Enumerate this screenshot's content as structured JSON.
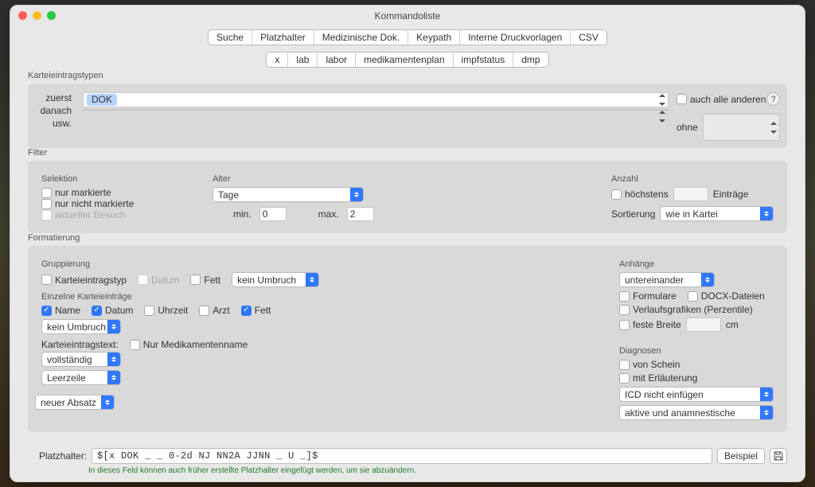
{
  "window": {
    "title": "Kommandoliste"
  },
  "tabs1": [
    "Suche",
    "Platzhalter",
    "Medizinische Dok.",
    "Keypath",
    "Interne Druckvorlagen",
    "CSV"
  ],
  "tabs1_selected": 2,
  "tabs2": [
    "x",
    "lab",
    "labor",
    "medikamentenplan",
    "impfstatus",
    "dmp"
  ],
  "tabs2_selected": 0,
  "kart": {
    "title": "Karteieintragstypen",
    "rows": [
      "zuerst",
      "danach",
      "usw."
    ],
    "first_tag": "DOK",
    "also_others": "auch alle anderen",
    "ohne": "ohne"
  },
  "filter": {
    "title": "Filter",
    "selektion": {
      "title": "Selektion",
      "items": [
        "nur markierte",
        "nur nicht markierte",
        "aktueller Besuch"
      ]
    },
    "alter": {
      "title": "Alter",
      "unit": "Tage",
      "min_label": "min.",
      "min": "0",
      "max_label": "max.",
      "max": "2"
    },
    "anzahl": {
      "title": "Anzahl",
      "at_most": "höchstens",
      "entries": "Einträge",
      "sort_label": "Sortierung",
      "sort_value": "wie in Kartei"
    }
  },
  "format": {
    "title": "Formatierung",
    "grupp": {
      "title": "Gruppierung",
      "items": [
        "Karteieintragstyp",
        "Datum",
        "Fett"
      ],
      "break": "kein Umbruch",
      "sub_title": "Einzelne Karteieinträge",
      "row2": [
        "Name",
        "Datum",
        "Uhrzeit",
        "Arzt",
        "Fett"
      ],
      "break2": "kein Umbruch",
      "text_label": "Karteieintragstext:",
      "only_med": "Nur Medikamentenname",
      "text_mode": "vollständig",
      "blank": "Leerzeile",
      "para": "neuer Absatz"
    },
    "anh": {
      "title": "Anhänge",
      "mode": "untereinander",
      "items": [
        "Formulare",
        "DOCX-Dateien",
        "Verlaufsgrafiken (Perzentile)",
        "feste Breite"
      ],
      "cm": "cm"
    },
    "diag": {
      "title": "Diagnosen",
      "items": [
        "von Schein",
        "mit Erläuterung"
      ],
      "icd": "ICD nicht einfügen",
      "active": "aktive und anamnestische"
    }
  },
  "footer": {
    "label": "Platzhalter:",
    "value": "$[x DOK _ _ 0-2d NJ NN2A JJNN _ U _]$",
    "example": "Beispiel",
    "hint": "In dieses Feld können auch früher erstellte Platzhalter eingefügt werden, um sie abzuändern."
  }
}
